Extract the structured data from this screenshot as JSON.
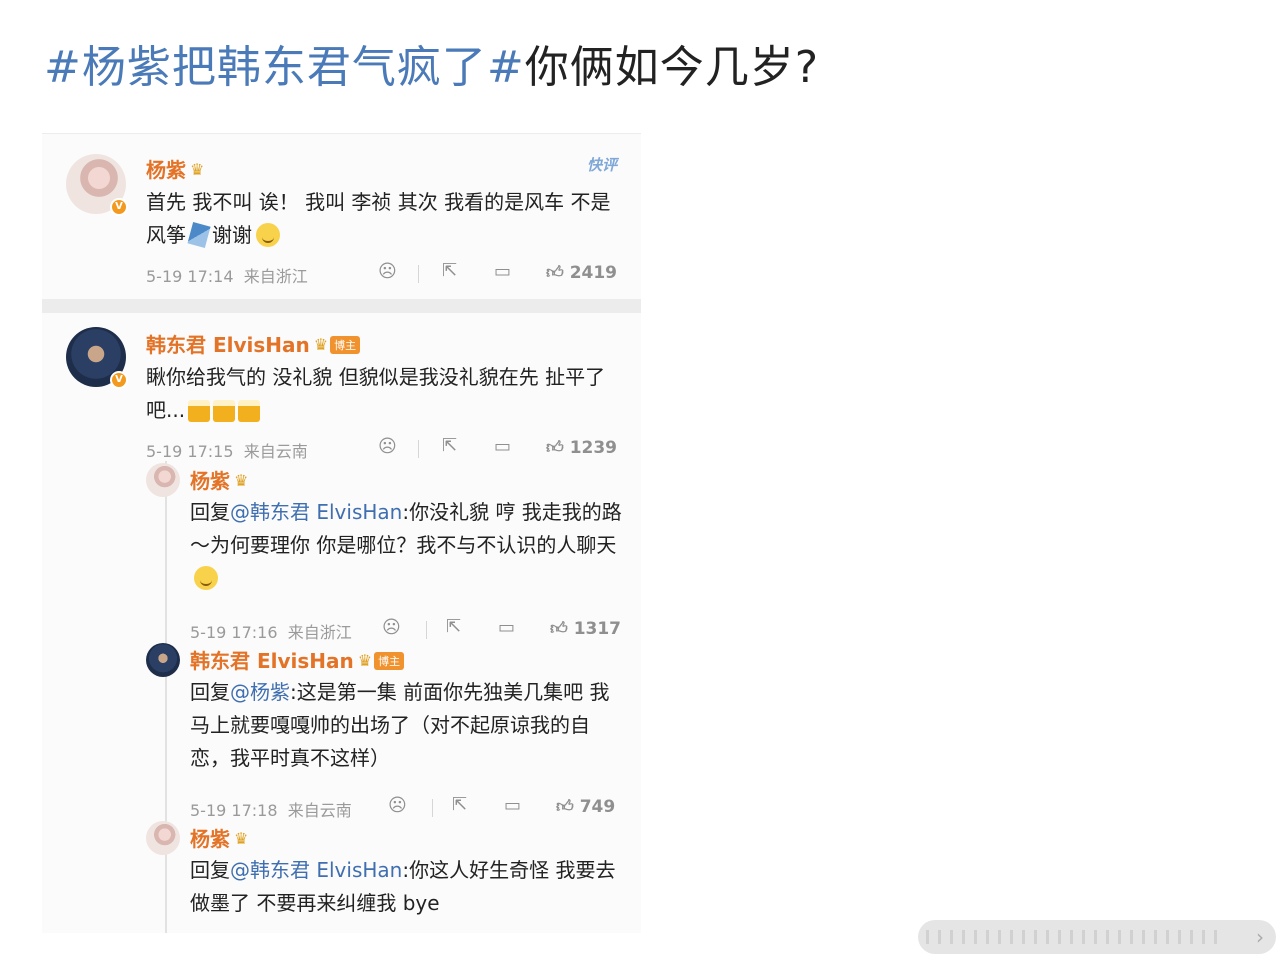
{
  "title": {
    "tag": "#杨紫把韩东君气疯了#",
    "rest": "你俩如今几岁?"
  },
  "comments": [
    {
      "user": "杨紫",
      "corner_label": "快评",
      "text": "首先 我不叫 诶！ 我叫 李祯 其次 我看的是风车 不是风筝",
      "text_tail": "谢谢",
      "time": "5-19 17:14",
      "location": "来自浙江",
      "likes": "2419"
    },
    {
      "user": "韩东君 ElvisHan",
      "badge": "博主",
      "text": "瞅你给我气的 没礼貌 但貌似是我没礼貌在先 扯平了吧...",
      "time": "5-19 17:15",
      "location": "来自云南",
      "likes": "1239"
    }
  ],
  "replies": [
    {
      "user": "杨紫",
      "reply_prefix": "回复",
      "mention": "@韩东君 ElvisHan",
      "text": ":你没礼貌 哼 我走我的路～为何要理你 你是哪位？我不与不认识的人聊天",
      "time": "5-19 17:16",
      "location": "来自浙江",
      "likes": "1317"
    },
    {
      "user": "韩东君 ElvisHan",
      "badge": "博主",
      "reply_prefix": "回复",
      "mention": "@杨紫",
      "text": ":这是第一集 前面你先独美几集吧 我马上就要嘎嘎帅的出场了（对不起原谅我的自恋，我平时真不这样）",
      "time": "5-19 17:18",
      "location": "来自云南",
      "likes": "749"
    },
    {
      "user": "杨紫",
      "reply_prefix": "回复",
      "mention": "@韩东君 ElvisHan",
      "text": ":你这人好生奇怪 我要去做墨了 不要再来纠缠我 bye"
    }
  ],
  "icons": [
    "dislike-icon",
    "share-icon",
    "comment-icon",
    "like-icon"
  ],
  "colors": {
    "tag_blue": "#4a7ab8",
    "username_orange": "#e37326",
    "mention_blue": "#3f6fb0"
  }
}
